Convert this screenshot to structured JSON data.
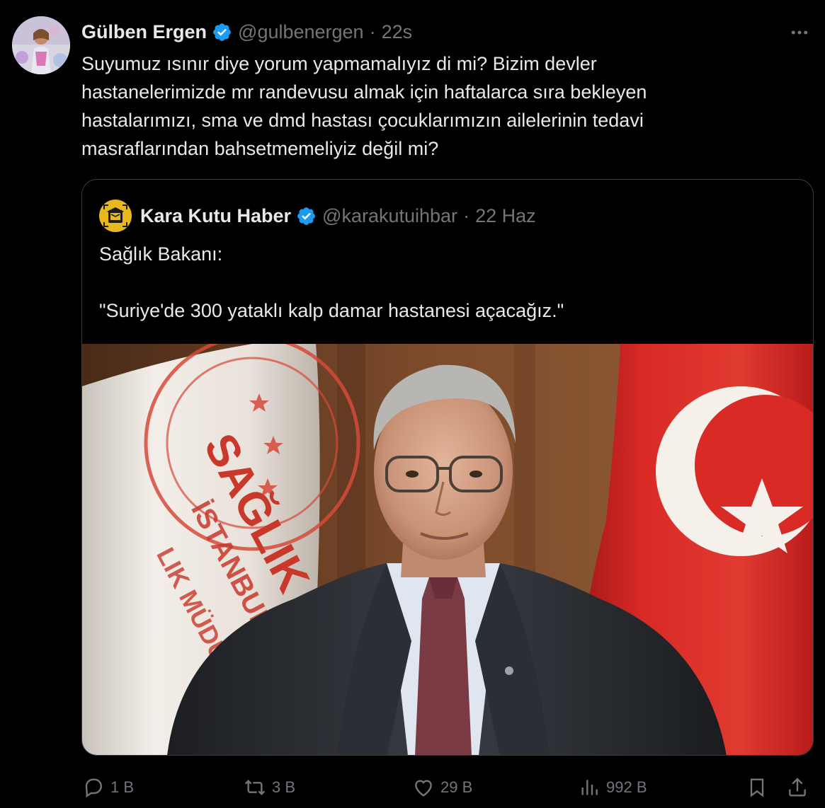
{
  "tweet": {
    "author_name": "Gülben Ergen",
    "handle": "@gulbenergen",
    "separator": "·",
    "time": "22s",
    "body_lines": [
      "Suyumuz ısınır diye yorum yapmamalıyız di mi? Bizim devler",
      "hastanelerimizde mr randevusu almak için haftalarca sıra bekleyen",
      "hastalarımızı, sma ve dmd hastası çocuklarımızın ailelerinin tedavi",
      "masraflarından bahsetmemeliyiz değil mi?"
    ]
  },
  "quote": {
    "author_name": "Kara Kutu Haber",
    "handle": "@karakutuihbar",
    "separator": "·",
    "time": "22 Haz",
    "text_line_1": "Sağlık Bakanı:",
    "text_line_2": "\"Suriye'de 300 yataklı kalp damar hastanesi açacağız.\"",
    "image_banner_text": "SAĞLIK BA",
    "image_banner_sub": "İSTANBUL",
    "image_banner_sub2": "LIK MÜDÜR"
  },
  "actions": {
    "reply_count": "1 B",
    "retweet_count": "3 B",
    "like_count": "29 B",
    "views_count": "992 B"
  },
  "icons": {
    "verified": "verified-badge-icon",
    "more": "more-icon",
    "reply": "reply-icon",
    "retweet": "retweet-icon",
    "like": "heart-icon",
    "views": "views-icon",
    "bookmark": "bookmark-icon",
    "share": "share-icon"
  },
  "colors": {
    "background": "#000000",
    "text": "#e7e9ea",
    "muted": "#71767b",
    "verified": "#1d9bf0",
    "border": "#3a3e42"
  }
}
